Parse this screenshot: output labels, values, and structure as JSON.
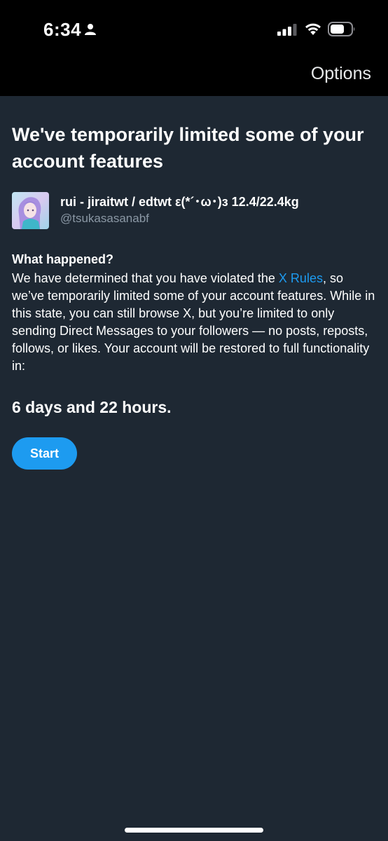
{
  "status_bar": {
    "time": "6:34",
    "icons": [
      "person-icon",
      "signal-icon",
      "wifi-icon",
      "battery-icon"
    ]
  },
  "header": {
    "options_label": "Options"
  },
  "notice": {
    "headline": "We've temporarily limited some of your account features",
    "user": {
      "display_name": "rui - jiraitwt / edtwt ε(*´･ω･)з 12.4/22.4kg",
      "handle": "@tsukasasanabf"
    },
    "section_title": "What happened?",
    "body_before_link": "We have determined that you have violated the ",
    "link_text": "X Rules",
    "body_after_link": ", so we’ve temporarily limited some of your account features. While in this state, you can still browse X, but you’re limited to only sending Direct Messages to your followers — no posts, reposts, follows, or likes. Your account will be restored to full functionality in:",
    "countdown": "6 days and 22 hours.",
    "start_label": "Start"
  },
  "colors": {
    "background": "#1e2833",
    "accent": "#1d9bf0",
    "secondary_text": "#8b98a5"
  }
}
